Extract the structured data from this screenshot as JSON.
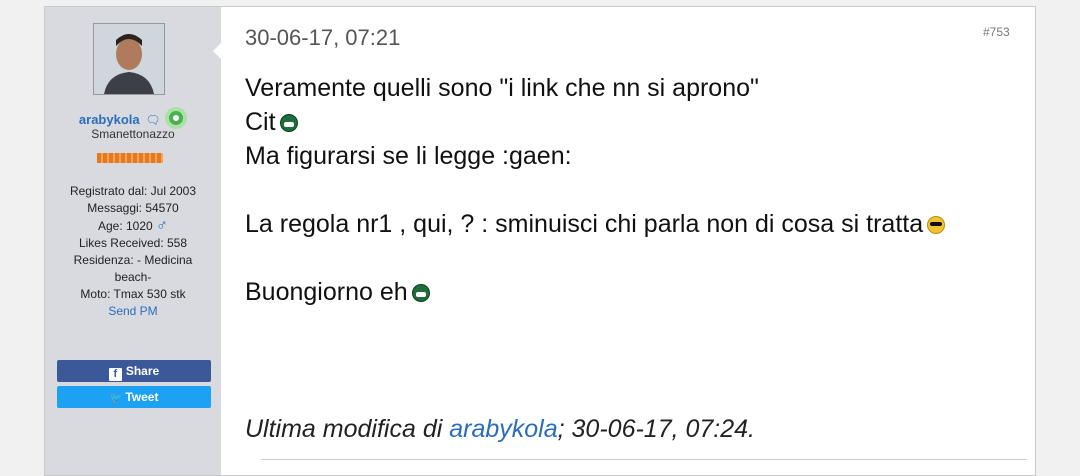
{
  "user": {
    "username": "arabykola",
    "title": "Smanettonazzo",
    "stats": [
      "Registrato dal: Jul 2003",
      "Messaggi: 54570",
      "Likes Received: 558",
      "Residenza: - Medicina beach-",
      "Moto: Tmax 530 stk"
    ],
    "age_label": "Age: 1020",
    "gender_symbol": "♂",
    "send_pm": "Send PM"
  },
  "share": {
    "share_label": "Share",
    "share_icon": "f",
    "tweet_label": "Tweet",
    "tweet_icon": "🐦"
  },
  "post": {
    "date": "30-06-17, 07:21",
    "number": "#753",
    "lines": {
      "l1": "Veramente quelli sono \"i link che nn si aprono\"",
      "l2": "Cit",
      "l3": "Ma figurarsi se li legge :gaen:",
      "l4": "La regola nr1 , qui, ? : sminuisci chi parla non di cosa si tratta",
      "l5": "Buongiorno eh"
    },
    "edit": {
      "prefix": "Ultima modifica di ",
      "user": "arabykola",
      "suffix": "; 30-06-17, 07:24."
    }
  },
  "colors": {
    "link": "#2a6ebb",
    "facebook": "#3b5998",
    "twitter": "#1da1f2",
    "online": "#4caf50"
  }
}
